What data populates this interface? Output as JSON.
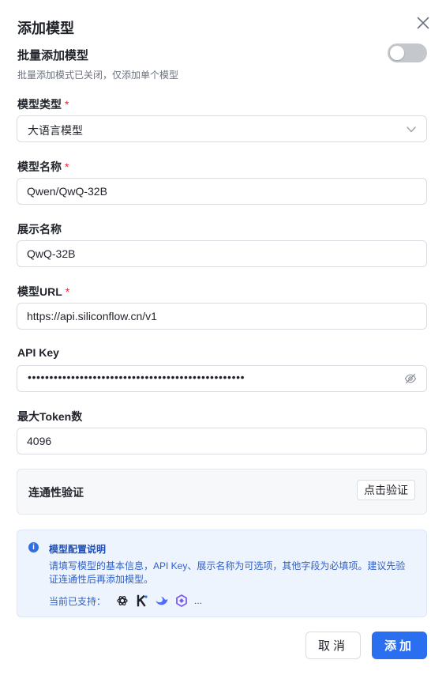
{
  "dialog": {
    "title": "添加模型"
  },
  "batch": {
    "label": "批量添加模型",
    "description": "批量添加模式已关闭，仅添加单个模型",
    "enabled": false
  },
  "fields": {
    "model_type": {
      "label": "模型类型",
      "required_mark": "*",
      "value": "大语言模型"
    },
    "model_name": {
      "label": "模型名称",
      "required_mark": "*",
      "value": "Qwen/QwQ-32B"
    },
    "display_name": {
      "label": "展示名称",
      "value": "QwQ-32B"
    },
    "model_url": {
      "label": "模型URL",
      "required_mark": "*",
      "value": "https://api.siliconflow.cn/v1"
    },
    "api_key": {
      "label": "API Key",
      "masked_value": "••••••••••••••••••••••••••••••••••••••••••••••••••"
    },
    "max_tokens": {
      "label": "最大Token数",
      "value": "4096"
    }
  },
  "connectivity": {
    "label": "连通性验证",
    "button_label": "点击验证"
  },
  "info": {
    "title": "模型配置说明",
    "text": "请填写模型的基本信息，API Key、展示名称为可选项，其他字段为必填项。建议先验证连通性后再添加模型。",
    "support_label": "当前已支持：",
    "more": "...",
    "logos": [
      "openai-logo-icon",
      "kimi-logo-icon",
      "deepseek-logo-icon",
      "qwen-logo-icon"
    ]
  },
  "actions": {
    "cancel_label": "取消",
    "add_label": "添加"
  },
  "colors": {
    "primary": "#2b6ff1",
    "required": "#f5222d",
    "info_bg": "#eef4fd",
    "toggle_off": "#c4c7cc"
  }
}
